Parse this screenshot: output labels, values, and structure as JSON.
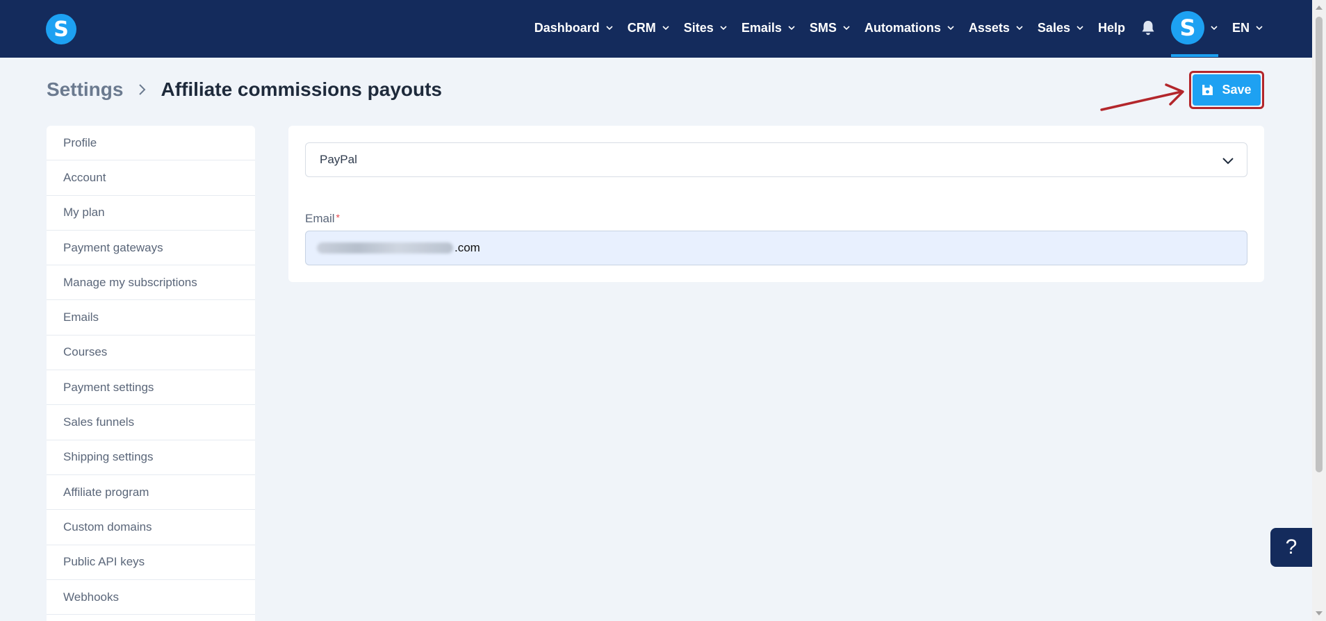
{
  "app": {
    "logo_letter": "S"
  },
  "nav": {
    "items": [
      {
        "label": "Dashboard",
        "dropdown": true
      },
      {
        "label": "CRM",
        "dropdown": true
      },
      {
        "label": "Sites",
        "dropdown": true
      },
      {
        "label": "Emails",
        "dropdown": true
      },
      {
        "label": "SMS",
        "dropdown": true
      },
      {
        "label": "Automations",
        "dropdown": true
      },
      {
        "label": "Assets",
        "dropdown": true
      },
      {
        "label": "Sales",
        "dropdown": true
      },
      {
        "label": "Help",
        "dropdown": false
      }
    ],
    "notifications_icon": "bell-icon",
    "avatar_letter": "S",
    "language": "EN"
  },
  "header": {
    "breadcrumb_root": "Settings",
    "page_title": "Affiliate commissions payouts",
    "save_label": "Save"
  },
  "sidebar": {
    "items": [
      {
        "label": "Profile"
      },
      {
        "label": "Account"
      },
      {
        "label": "My plan"
      },
      {
        "label": "Payment gateways"
      },
      {
        "label": "Manage my subscriptions"
      },
      {
        "label": "Emails"
      },
      {
        "label": "Courses"
      },
      {
        "label": "Payment settings"
      },
      {
        "label": "Sales funnels"
      },
      {
        "label": "Shipping settings"
      },
      {
        "label": "Affiliate program"
      },
      {
        "label": "Custom domains"
      },
      {
        "label": "Public API keys"
      },
      {
        "label": "Webhooks"
      }
    ]
  },
  "form": {
    "payout_method": "PayPal",
    "email_label": "Email",
    "email_required_mark": "*",
    "email_value_visible": ".com"
  },
  "help": {
    "label": "?"
  },
  "colors": {
    "topbar": "#142b5c",
    "accent": "#1ea1f2",
    "annotation": "#b3262b",
    "background": "#f0f4f9"
  }
}
